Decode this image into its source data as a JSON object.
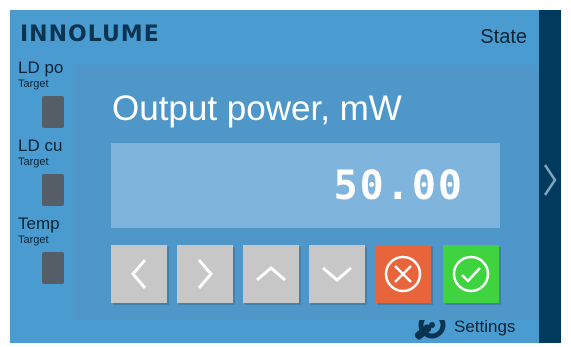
{
  "app": {
    "logo_text": "INNOLUME",
    "state_label": "State",
    "settings_label": "Settings"
  },
  "background_rows": [
    {
      "label": "LD po",
      "sub": "Target"
    },
    {
      "label": "LD cu",
      "sub": "Target"
    },
    {
      "label": "Temp",
      "sub": "Target"
    }
  ],
  "dialog": {
    "title": "Output power, mW",
    "value": "50.00"
  },
  "buttons": {
    "left_icon": "chevron-left-icon",
    "right_icon": "chevron-right-icon",
    "up_icon": "chevron-up-icon",
    "down_icon": "chevron-down-icon",
    "cancel_icon": "circle-x-icon",
    "ok_icon": "circle-check-icon"
  },
  "colors": {
    "screen_bg": "#4a9cd0",
    "dialog_bg": "#4f97c8",
    "value_bg": "#7fb4dc",
    "side_panel": "#003a5c",
    "cancel": "#e8643a",
    "ok": "#3fd33f",
    "nav_button": "#c7c7c7"
  }
}
